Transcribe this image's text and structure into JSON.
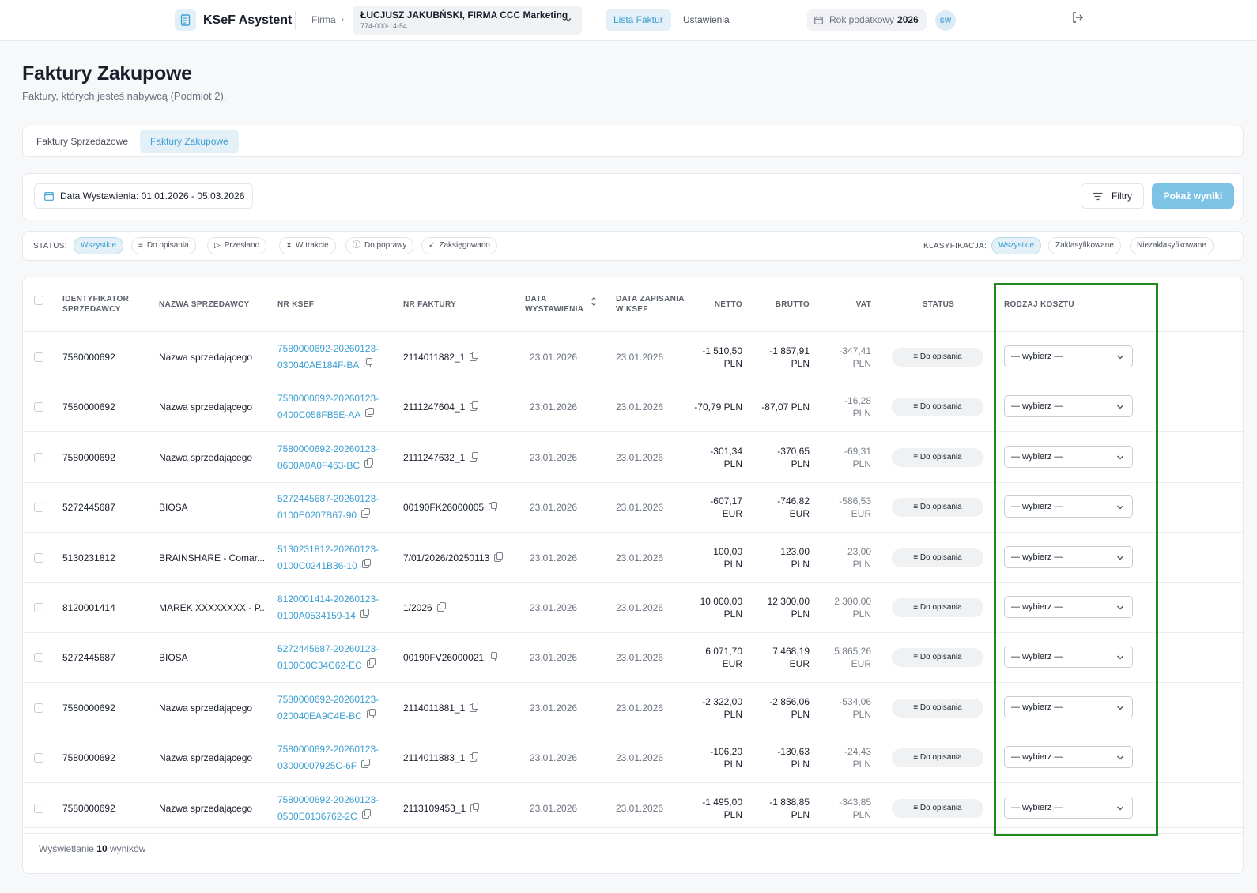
{
  "app": {
    "name": "KSeF Asystent"
  },
  "nav": {
    "firma_label": "Firma",
    "company_name": "ŁUCJUSZ JAKUBŃSKI, FIRMA CCC Marketing",
    "company_nip": "774-000-14-54",
    "lista_faktur": "Lista Faktur",
    "ustawienia": "Ustawienia",
    "tax_year_label": "Rok podatkowy",
    "tax_year": "2026",
    "avatar": "SW"
  },
  "page": {
    "title": "Faktury Zakupowe",
    "subtitle": "Faktury, których jesteś nabywcą (Podmiot 2)."
  },
  "tabs": [
    {
      "label": "Faktury Sprzedażowe",
      "active": false
    },
    {
      "label": "Faktury Zakupowe",
      "active": true
    }
  ],
  "filters": {
    "date_range": "Data Wystawienia: 01.01.2026 - 05.03.2026",
    "filters_label": "Filtry",
    "show_label": "Pokaż wyniki"
  },
  "status_filter": {
    "label": "STATUS:",
    "items": [
      "Wszystkie",
      "Do opisania",
      "Przesłano",
      "W trakcie",
      "Do poprawy",
      "Zaksięgowano"
    ]
  },
  "class_filter": {
    "label": "KLASYFIKACJA:",
    "items": [
      "Wszystkie",
      "Zaklasyfikowane",
      "Niezaklasyfikowane"
    ]
  },
  "table": {
    "headers": {
      "seller_id": "IDENTYFIKATOR SPRZEDAWCY",
      "seller_name": "NAZWA SPRZEDAWCY",
      "ksef": "NR KSEF",
      "invoice": "NR FAKTURY",
      "issue_date": "DATA WYSTAWIENIA",
      "ksef_date": "DATA ZAPISANIA W KSEF",
      "net": "NETTO",
      "gross": "BRUTTO",
      "vat": "VAT",
      "status": "STATUS",
      "cost": "RODZAJ KOSZTU"
    },
    "rows": [
      {
        "seller_id": "7580000692",
        "seller_name": "Nazwa sprzedającego",
        "ksef1": "7580000692-20260123-",
        "ksef2": "030040AE184F-BA",
        "invoice": "2114011882_1",
        "issue_date": "23.01.2026",
        "ksef_date": "23.01.2026",
        "net1": "-1 510,50",
        "net2": "PLN",
        "gross1": "-1 857,91",
        "gross2": "PLN",
        "vat1": "-347,41",
        "vat2": "PLN",
        "status": "Do opisania",
        "cost": "— wybierz —"
      },
      {
        "seller_id": "7580000692",
        "seller_name": "Nazwa sprzedającego",
        "ksef1": "7580000692-20260123-",
        "ksef2": "0400C058FB5E-AA",
        "invoice": "2111247604_1",
        "issue_date": "23.01.2026",
        "ksef_date": "23.01.2026",
        "net1": "-70,79 PLN",
        "net2": "",
        "gross1": "-87,07 PLN",
        "gross2": "",
        "vat1": "-16,28",
        "vat2": "PLN",
        "status": "Do opisania",
        "cost": "— wybierz —"
      },
      {
        "seller_id": "7580000692",
        "seller_name": "Nazwa sprzedającego",
        "ksef1": "7580000692-20260123-",
        "ksef2": "0600A0A0F463-BC",
        "invoice": "2111247632_1",
        "issue_date": "23.01.2026",
        "ksef_date": "23.01.2026",
        "net1": "-301,34",
        "net2": "PLN",
        "gross1": "-370,65",
        "gross2": "PLN",
        "vat1": "-69,31",
        "vat2": "PLN",
        "status": "Do opisania",
        "cost": "— wybierz —"
      },
      {
        "seller_id": "5272445687",
        "seller_name": "BIOSA",
        "ksef1": "5272445687-20260123-",
        "ksef2": "0100E0207B67-90",
        "invoice": "00190FK26000005",
        "issue_date": "23.01.2026",
        "ksef_date": "23.01.2026",
        "net1": "-607,17",
        "net2": "EUR",
        "gross1": "-746,82",
        "gross2": "EUR",
        "vat1": "-586,53",
        "vat2": "EUR",
        "status": "Do opisania",
        "cost": "— wybierz —"
      },
      {
        "seller_id": "5130231812",
        "seller_name": "BRAINSHARE - Comar...",
        "ksef1": "5130231812-20260123-",
        "ksef2": "0100C0241B36-10",
        "invoice": "7/01/2026/20250113",
        "issue_date": "23.01.2026",
        "ksef_date": "23.01.2026",
        "net1": "100,00",
        "net2": "PLN",
        "gross1": "123,00",
        "gross2": "PLN",
        "vat1": "23,00",
        "vat2": "PLN",
        "status": "Do opisania",
        "cost": "— wybierz —"
      },
      {
        "seller_id": "8120001414",
        "seller_name": "MAREK XXXXXXXX - P...",
        "ksef1": "8120001414-20260123-",
        "ksef2": "0100A0534159-14",
        "invoice": "1/2026",
        "issue_date": "23.01.2026",
        "ksef_date": "23.01.2026",
        "net1": "10 000,00",
        "net2": "PLN",
        "gross1": "12 300,00",
        "gross2": "PLN",
        "vat1": "2 300,00",
        "vat2": "PLN",
        "status": "Do opisania",
        "cost": "— wybierz —"
      },
      {
        "seller_id": "5272445687",
        "seller_name": "BIOSA",
        "ksef1": "5272445687-20260123-",
        "ksef2": "0100C0C34C62-EC",
        "invoice": "00190FV26000021",
        "issue_date": "23.01.2026",
        "ksef_date": "23.01.2026",
        "net1": "6 071,70",
        "net2": "EUR",
        "gross1": "7 468,19",
        "gross2": "EUR",
        "vat1": "5 865,26",
        "vat2": "EUR",
        "status": "Do opisania",
        "cost": "— wybierz —"
      },
      {
        "seller_id": "7580000692",
        "seller_name": "Nazwa sprzedającego",
        "ksef1": "7580000692-20260123-",
        "ksef2": "020040EA9C4E-BC",
        "invoice": "2114011881_1",
        "issue_date": "23.01.2026",
        "ksef_date": "23.01.2026",
        "net1": "-2 322,00",
        "net2": "PLN",
        "gross1": "-2 856,06",
        "gross2": "PLN",
        "vat1": "-534,06",
        "vat2": "PLN",
        "status": "Do opisania",
        "cost": "— wybierz —"
      },
      {
        "seller_id": "7580000692",
        "seller_name": "Nazwa sprzedającego",
        "ksef1": "7580000692-20260123-",
        "ksef2": "03000007925C-6F",
        "invoice": "2114011883_1",
        "issue_date": "23.01.2026",
        "ksef_date": "23.01.2026",
        "net1": "-106,20",
        "net2": "PLN",
        "gross1": "-130,63",
        "gross2": "PLN",
        "vat1": "-24,43",
        "vat2": "PLN",
        "status": "Do opisania",
        "cost": "— wybierz —"
      },
      {
        "seller_id": "7580000692",
        "seller_name": "Nazwa sprzedającego",
        "ksef1": "7580000692-20260123-",
        "ksef2": "0500E0136762-2C",
        "invoice": "2113109453_1",
        "issue_date": "23.01.2026",
        "ksef_date": "23.01.2026",
        "net1": "-1 495,00",
        "net2": "PLN",
        "gross1": "-1 838,85",
        "gross2": "PLN",
        "vat1": "-343,85",
        "vat2": "PLN",
        "status": "Do opisania",
        "cost": "— wybierz —"
      }
    ],
    "footer_prefix": "Wyświetlanie",
    "footer_count": "10",
    "footer_suffix": "wyników"
  },
  "colors": {
    "accent": "#3d9fd1",
    "accent_bg": "#e3f0f8",
    "button": "#7cc3e6",
    "highlight": "#1e8a1e"
  }
}
